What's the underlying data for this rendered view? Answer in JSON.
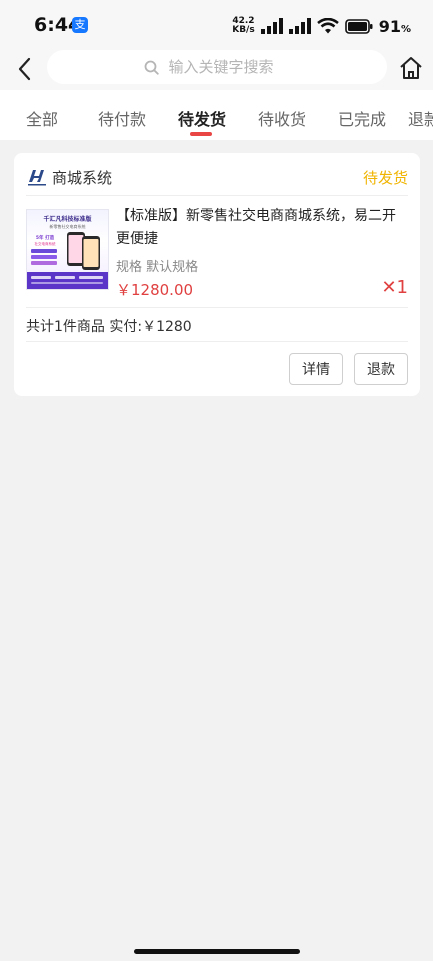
{
  "status_bar": {
    "time": "6:44",
    "app_badge": "支",
    "net_speed_value": "42.2",
    "net_speed_unit": "KB/s",
    "battery": "91",
    "battery_unit": "%"
  },
  "search": {
    "placeholder": "输入关键字搜索"
  },
  "tabs": [
    {
      "label": "全部"
    },
    {
      "label": "待付款"
    },
    {
      "label": "待发货"
    },
    {
      "label": "待收货"
    },
    {
      "label": "已完成"
    },
    {
      "label": "退款"
    }
  ],
  "active_tab": "待发货",
  "order": {
    "shop_name": "商城系统",
    "status": "待发货",
    "product": {
      "title": "【标准版】新零售社交电商商城系统，易二开更便捷",
      "spec": "规格 默认规格",
      "price": "￥1280.00",
      "quantity": "✕1",
      "image_texts": {
        "heading": "千汇凡科技标准版",
        "sub": "新零售社交电商系统",
        "promo": "5年 打造",
        "tagline": "社交电商系统"
      }
    },
    "summary": "共计1件商品 实付:￥1280",
    "buttons": {
      "detail": "详情",
      "refund": "退款"
    }
  },
  "colors": {
    "accent_red": "#e94545",
    "price_red": "#e04040",
    "status_yellow": "#f0b400"
  }
}
